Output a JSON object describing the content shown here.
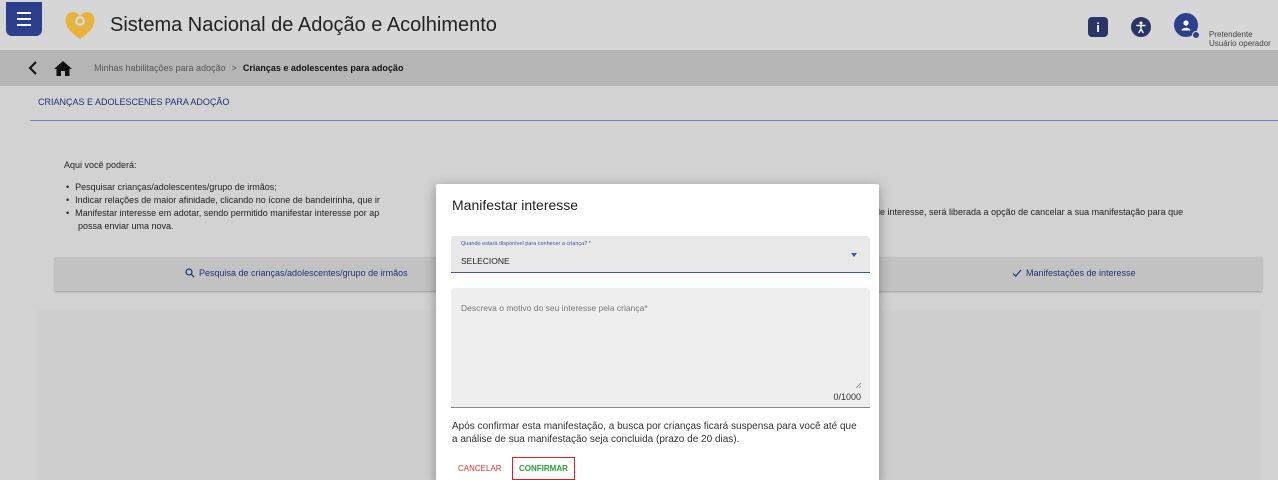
{
  "header": {
    "app_title": "Sistema Nacional de Adoção e Acolhimento",
    "info_icon_glyph": "i",
    "user_role": "Pretendente",
    "user_type": "Usuário operador",
    "brand_color": "#2c3f8d",
    "logo_color": "#e8b33c"
  },
  "breadcrumb": {
    "items": [
      "Minhas habilitações para adoção",
      "Crianças e adolescentes para adoção"
    ],
    "separator": ">"
  },
  "page": {
    "heading": "CRIANÇAS E ADOLESCENES PARA ADOÇÃO",
    "intro": "Aqui você poderá:",
    "bullets": [
      "Pesquisar crianças/adolescentes/grupo de irmãos;",
      "Indicar relações de maior afinidade, clicando no ícone de bandeirinha, que ir",
      "Manifestar interesse em adotar, sendo permitido manifestar interesse por ap",
      "possa enviar uma nova."
    ],
    "bullet_right_fragment": "le interesse, será liberada a opção de cancelar a sua manifestação para que",
    "tabs": {
      "search": "Pesquisa de crianças/adolescentes/grupo de irmãos",
      "manifestations": "Manifestações de interesse"
    }
  },
  "modal": {
    "title": "Manifestar interesse",
    "select_label": "Quando estará disponível para conhecer a criança? *",
    "select_value": "SELECIONE",
    "textarea_placeholder": "Descreva o motivo do seu interesse pela criança*",
    "counter": "0/1000",
    "notice": "Após confirmar esta manifestação, a busca por crianças ficará suspensa para você até que a análise de sua manifestação seja concluida (prazo de 20 dias).",
    "cancel_label": "CANCELAR",
    "confirm_label": "CONFIRMAR",
    "cancel_color": "#d93535",
    "confirm_color": "#2c9a3a"
  },
  "icons": [
    "menu-icon",
    "logo-icon",
    "info-icon",
    "accessibility-icon",
    "user-icon",
    "back-arrow-icon",
    "home-icon",
    "search-icon",
    "check-icon",
    "dropdown-arrow-icon",
    "resize-handle-icon"
  ]
}
